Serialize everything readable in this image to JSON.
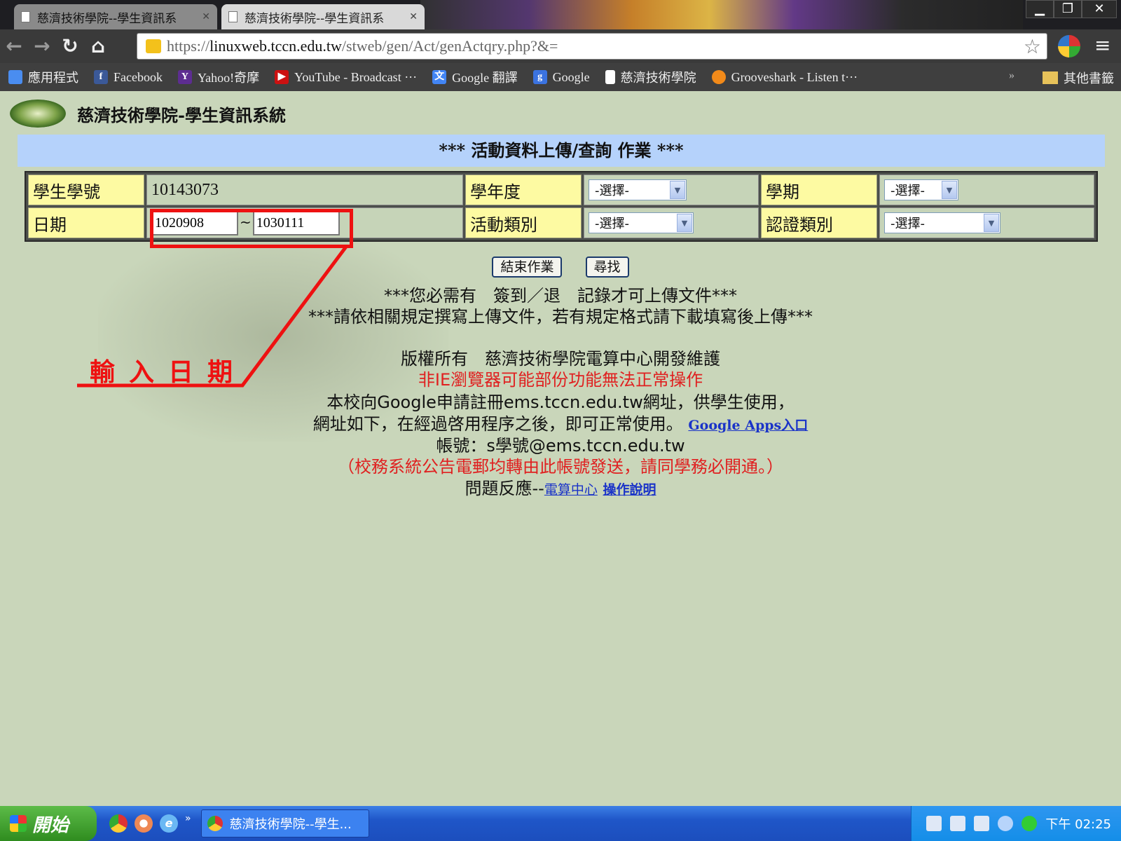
{
  "browser": {
    "tabs": [
      {
        "title": "慈濟技術學院--學生資訊系",
        "active": false
      },
      {
        "title": "慈濟技術學院--學生資訊系",
        "active": true
      }
    ],
    "window_buttons": {
      "minimize": "▁",
      "restore": "❐",
      "close": "✕"
    },
    "url_prefix": "https://",
    "url_host": "linuxweb.tccn.edu.tw",
    "url_path": "/stweb/gen/Act/genActqry.php?&=",
    "bookmarks": [
      {
        "label": "應用程式",
        "icon": "apps-grid-icon",
        "color": "#4a8df0"
      },
      {
        "label": "Facebook",
        "icon": "facebook-icon",
        "color": "#3b5998"
      },
      {
        "label": "Yahoo!奇摩",
        "icon": "yahoo-icon",
        "color": "#5d2d91"
      },
      {
        "label": "YouTube - Broadcast ···",
        "icon": "youtube-icon",
        "color": "#cc1111"
      },
      {
        "label": "Google 翻譯",
        "icon": "google-translate-icon",
        "color": "#4285f4"
      },
      {
        "label": "Google",
        "icon": "google-icon",
        "color": "#3b73e0"
      },
      {
        "label": "慈濟技術學院",
        "icon": "page-icon",
        "color": "#ffffff"
      },
      {
        "label": "Grooveshark - Listen t···",
        "icon": "grooveshark-icon",
        "color": "#f28a19"
      }
    ],
    "bookmarks_overflow": "»",
    "other_bookmarks": "其他書籤"
  },
  "site": {
    "title": "慈濟技術學院-學生資訊系統",
    "banner": "*** 活動資料上傳/查詢 作業 ***"
  },
  "form": {
    "student_id_label": "學生學號",
    "student_id_value": "10143073",
    "school_year_label": "學年度",
    "school_year_value": "-選擇-",
    "semester_label": "學期",
    "semester_value": "-選擇-",
    "date_label": "日期",
    "date_from": "1020908",
    "date_sep": "~",
    "date_to": "1030111",
    "activity_type_label": "活動類別",
    "activity_type_value": "-選擇-",
    "cert_type_label": "認證類別",
    "cert_type_value": "-選擇-"
  },
  "buttons": {
    "end": "結束作業",
    "search": "尋找"
  },
  "notices": {
    "line1": "***您必需有　簽到／退　記錄才可上傳文件***",
    "line2": "***請依相關規定撰寫上傳文件，若有規定格式請下載填寫後上傳***",
    "copyright": "版權所有　慈濟技術學院電算中心開發維護",
    "browser_warning": "非IE瀏覽器可能部份功能無法正常操作",
    "google_line1": "本校向Google申請註冊ems.tccn.edu.tw網址，供學生使用，",
    "google_line2": "網址如下，在經過啓用程序之後，即可正常使用。",
    "google_apps_link": "Google Apps入口",
    "account": "帳號：s學號@ems.tccn.edu.tw",
    "account_note": "（校務系統公告電郵均轉由此帳號發送，請同學務必開通。）",
    "feedback_prefix": "問題反應--",
    "computer_center_link": "電算中心",
    "manual_link": "操作說明"
  },
  "annotation": {
    "label": "輸入日期",
    "color": "#ee1111"
  },
  "taskbar": {
    "start": "開始",
    "quick_launch_overflow": "»",
    "task_title": "慈濟技術學院--學生...",
    "clock": "下午 02:25"
  }
}
